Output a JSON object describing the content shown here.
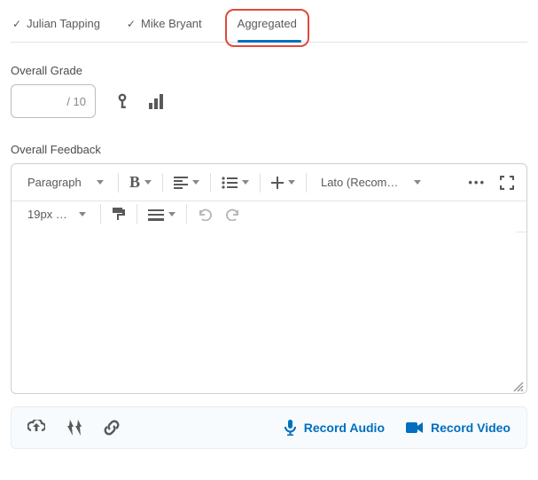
{
  "tabs": {
    "0": {
      "label": "Julian Tapping"
    },
    "1": {
      "label": "Mike Bryant"
    },
    "2": {
      "label": "Aggregated"
    }
  },
  "grade": {
    "section_label": "Overall Grade",
    "max": "/ 10"
  },
  "feedback": {
    "section_label": "Overall Feedback"
  },
  "editor": {
    "style_dropdown": "Paragraph",
    "font_dropdown": "Lato (Recom…",
    "size_dropdown": "19px …"
  },
  "attach": {
    "record_audio": "Record Audio",
    "record_video": "Record Video"
  },
  "colors": {
    "accent": "#006fbf",
    "highlight_border": "#e2483d"
  }
}
